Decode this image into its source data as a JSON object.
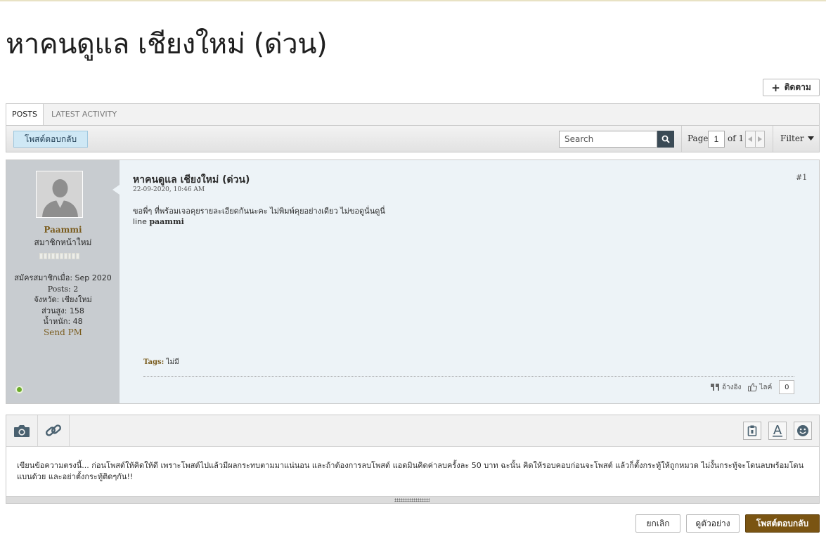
{
  "thread": {
    "title": "หาคนดูแล เชียงใหม่ (ด่วน)",
    "follow_label": "ติดตาม"
  },
  "tabs": [
    {
      "label": "Posts",
      "active": true
    },
    {
      "label": "Latest Activity",
      "active": false
    }
  ],
  "toolbar": {
    "reply_label": "โพสต์ตอบกลับ",
    "search_placeholder": "Search",
    "page_label": "Page",
    "page_value": "1",
    "of_label": "of 1",
    "filter_label": "Filter"
  },
  "post": {
    "number": "#1",
    "title": "หาคนดูแล เชียงใหม่ (ด่วน)",
    "date": "22-09-2020, 10:46 AM",
    "body_line1": "ขอพี่ๆ ที่พร้อมเจอคุยรายละเอียดกันนะคะ ไม่พิมพ์คุยอย่างเดียว ไม่ขอดูนั่นดูนี่",
    "body_line2_prefix": "line ",
    "body_line2_bold": "paammi",
    "tags_label": "Tags:",
    "tags_value": "ไม่มี",
    "quote_label": "อ้างอิง",
    "like_label": "ไลค์",
    "like_count": "0"
  },
  "user": {
    "name": "Paammi",
    "title": "สมาชิกหน้าใหม่",
    "joined": "สมัครสมาชิกเมื่อ: Sep 2020",
    "posts": "Posts: 2",
    "province": "จังหวัด: เชียงใหม่",
    "height": "ส่วนสูง: 158",
    "weight": "น้ำหนัก: 48",
    "send_pm": "Send PM",
    "online": true
  },
  "editor": {
    "text": "เขียนข้อความตรงนี้... ก่อนโพสต์ให้คิดให้ดี เพราะโพสต์ไปแล้วมีผลกระทบตามมาแน่นอน และถ้าต้องการลบโพสต์ แอดมินคิดค่าลบครั้งละ 50 บาท ฉะนั้น คิดให้รอบคอบก่อนจะโพสต์ แล้วก็ตั้งกระทู้ให้ถูกหมวด ไม่งั้นกระทู้จะโดนลบพร้อมโดนแบนด้วย และอย่าตั้งกระทู้ติดๆกัน!!"
  },
  "buttons": {
    "cancel": "ยกเลิก",
    "preview": "ดูตัวอย่าง",
    "submit": "โพสต์ตอบกลับ"
  },
  "colors": {
    "accent": "#7a5412",
    "username": "#7a5c1e",
    "online": "#6cab2a",
    "reply_button": "#cfe8f5"
  }
}
